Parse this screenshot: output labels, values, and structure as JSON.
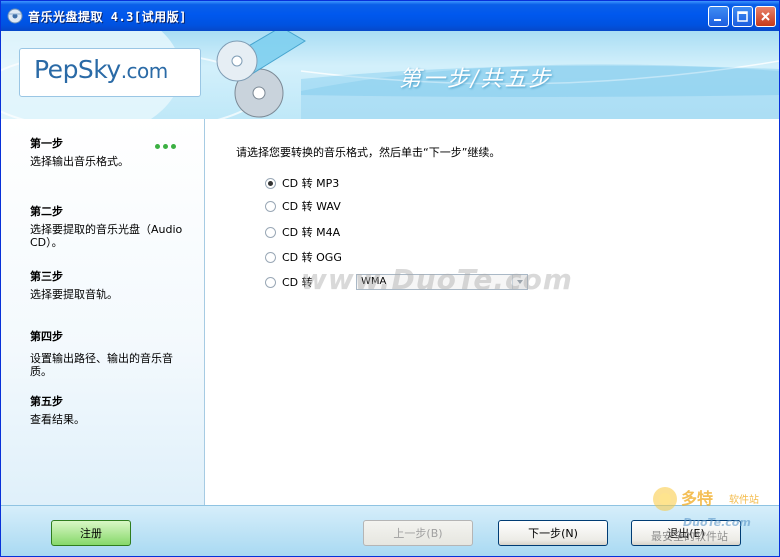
{
  "window": {
    "title": "音乐光盘提取 4.3[试用版]"
  },
  "header": {
    "logo_main": "PepSky",
    "logo_suffix": ".com",
    "step_title": "第一步/共五步"
  },
  "sidebar": {
    "steps": [
      {
        "name": "第一步",
        "desc": "选择输出音乐格式。"
      },
      {
        "name": "第二步",
        "desc": "选择要提取的音乐光盘（Audio CD）。"
      },
      {
        "name": "第三步",
        "desc": "选择要提取音轨。"
      },
      {
        "name": "第四步",
        "desc": "设置输出路径、输出的音乐音质。"
      },
      {
        "name": "第五步",
        "desc": "查看结果。"
      }
    ]
  },
  "content": {
    "instruction": "请选择您要转换的音乐格式，然后单击“下一步”继续。",
    "options": [
      {
        "label": "CD 转 MP3",
        "checked": true
      },
      {
        "label": "CD 转 WAV",
        "checked": false
      },
      {
        "label": "CD 转 M4A",
        "checked": false
      },
      {
        "label": "CD 转 OGG",
        "checked": false
      },
      {
        "label": "CD 转",
        "checked": false
      }
    ],
    "select_value": "WMA"
  },
  "watermark": "www.DuoTe.com",
  "buttons": {
    "register": "注册",
    "prev": "上一步(B)",
    "next": "下一步(N)",
    "exit": "退出(E)"
  },
  "corner_watermark": {
    "brand": "多特",
    "sub": "软件站",
    "site": "DuoTe.com",
    "slogan": "最安全的软件站"
  },
  "colors": {
    "titlebar": "#0058ee",
    "header_bg": "#bfe8f8",
    "bottombar_bg": "#a8d9f2",
    "register_green": "#86d86a"
  }
}
